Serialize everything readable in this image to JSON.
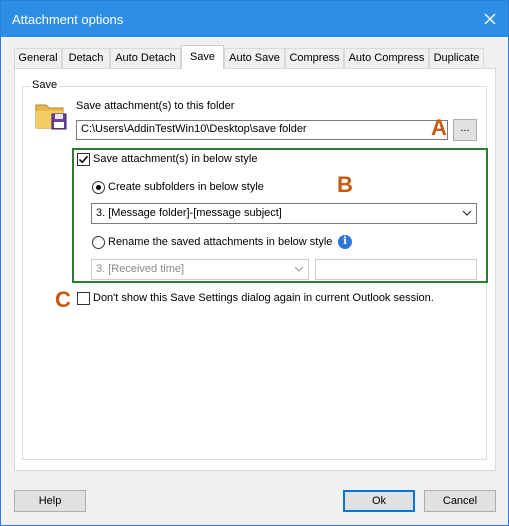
{
  "window": {
    "title": "Attachment options",
    "close_glyph": "close-icon"
  },
  "tabs": [
    {
      "label": "General"
    },
    {
      "label": "Detach"
    },
    {
      "label": "Auto Detach"
    },
    {
      "label": "Save"
    },
    {
      "label": "Auto Save"
    },
    {
      "label": "Compress"
    },
    {
      "label": "Auto Compress"
    },
    {
      "label": "Duplicate"
    }
  ],
  "active_tab": "Save",
  "save_group": {
    "legend": "Save",
    "folder_label": "Save attachment(s) to this folder",
    "folder_path": "C:\\Users\\AddinTestWin10\\Desktop\\save folder",
    "browse_label": "...",
    "style_checkbox_label": "Save attachment(s) in below style",
    "style_checkbox_checked": true,
    "subfolder_radio_label": "Create subfolders in below style",
    "subfolder_radio_checked": true,
    "subfolder_style_value": "3. [Message folder]-[message subject]",
    "rename_radio_label": "Rename the saved attachments in below style",
    "rename_radio_checked": false,
    "rename_style_value": "3. [Received time]",
    "rename_text_value": "",
    "dont_show_label": "Don't show this Save Settings dialog again in current Outlook session.",
    "dont_show_checked": false
  },
  "markers": {
    "a": "A",
    "b": "B",
    "c": "C"
  },
  "buttons": {
    "help": "Help",
    "ok": "Ok",
    "cancel": "Cancel"
  },
  "colors": {
    "titlebar": "#2d8ee6",
    "marker": "#c55a11",
    "highlight_box": "#2e7d32",
    "default_button_border": "#0078d7"
  }
}
